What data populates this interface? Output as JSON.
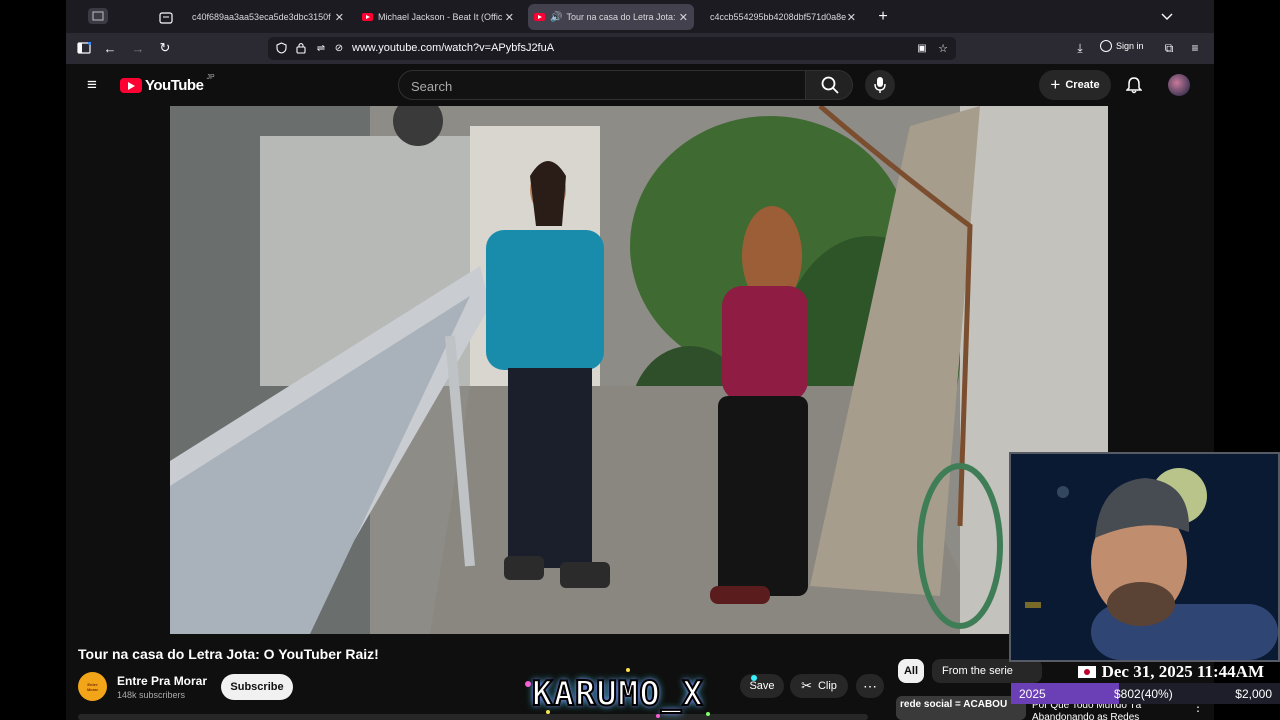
{
  "browser": {
    "tabs": [
      {
        "label": "c40f689aa3aa53eca5de3dbc3150f",
        "active": false,
        "favicon": "generic"
      },
      {
        "label": "Michael Jackson - Beat It (Offic",
        "active": false,
        "favicon": "youtube"
      },
      {
        "label": "Tour na casa do Letra Jota:",
        "active": true,
        "favicon": "youtube",
        "audio": "speaker-icon"
      },
      {
        "label": "c4ccb554295bb4208dbf571d0a8e",
        "active": false,
        "favicon": "generic"
      }
    ],
    "url": "www.youtube.com/watch?v=APybfsJ2fuA",
    "sign_in": "Sign in"
  },
  "youtube": {
    "logo_text": "YouTube",
    "region": "JP",
    "search_placeholder": "Search",
    "create_label": "Create"
  },
  "video": {
    "title": "Tour na casa do Letra Jota: O YouTuber Raiz!",
    "channel": "Entre Pra Morar",
    "subscribers": "148k subscribers",
    "channel_avatar_text": "Entre Morar",
    "subscribe_label": "Subscribe",
    "save_label": "Save",
    "clip_label": "Clip",
    "more_label": "⋯"
  },
  "chips": [
    {
      "label": "All",
      "selected": true
    },
    {
      "label": "From the serie",
      "selected": false
    }
  ],
  "recommended": {
    "title_line1": "rede social = ACABOU",
    "title_line2": "Por Que Todo Mundo Tá",
    "title_line3": "Abandonando as Redes"
  },
  "overlay": {
    "datetime": "Dec 31, 2025 11:44AM",
    "year": "2025",
    "progress": "$802(40%)",
    "goal": "$2,000",
    "progress_fraction": 0.4,
    "logo_text": "KARUMO_X"
  },
  "colors": {
    "accent_red": "#ff0033",
    "progress_purple": "#6b3fb5"
  }
}
